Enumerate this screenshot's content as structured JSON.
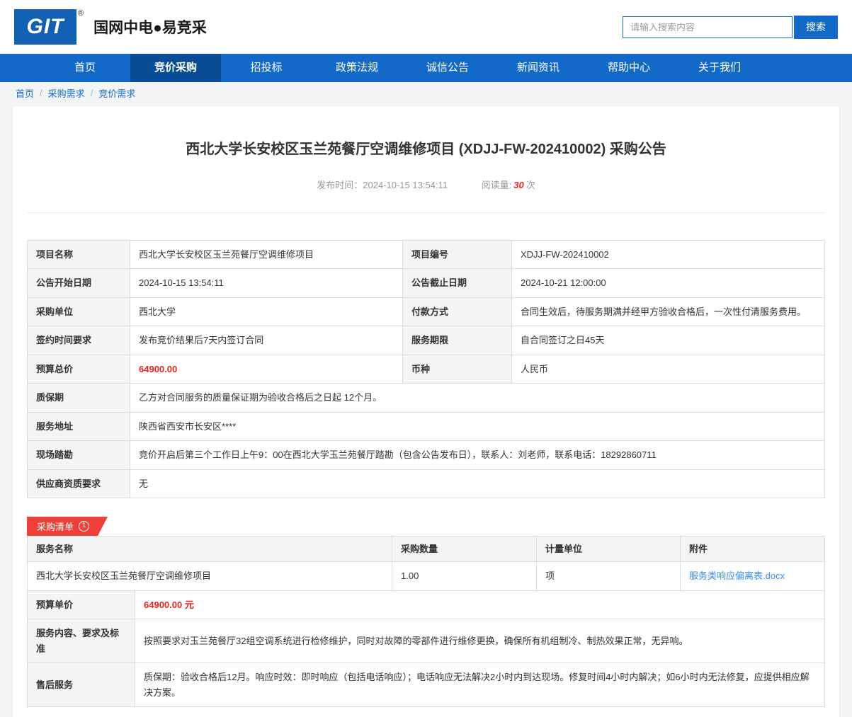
{
  "colors": {
    "brand-blue": "#1269c7",
    "nav-active": "#0a4d94",
    "accent-red": "#ee4038",
    "price-red": "#e6231f",
    "link-blue": "#3a8ee6"
  },
  "header": {
    "logo_text": "GIT",
    "logo_reg": "®",
    "site_title": "国网中电●易竞采",
    "search_placeholder": "请输入搜索内容",
    "search_button": "搜索"
  },
  "nav": {
    "items": [
      {
        "label": "首页"
      },
      {
        "label": "竞价采购"
      },
      {
        "label": "招投标"
      },
      {
        "label": "政策法规"
      },
      {
        "label": "诚信公告"
      },
      {
        "label": "新闻资讯"
      },
      {
        "label": "帮助中心"
      },
      {
        "label": "关于我们"
      }
    ]
  },
  "breadcrumb": {
    "sep": "/",
    "items": [
      "首页",
      "采购需求",
      "竞价需求"
    ]
  },
  "announcement": {
    "title": "西北大学长安校区玉兰苑餐厅空调维修项目 (XDJJ-FW-202410002) 采购公告",
    "publish_label": "发布时间：",
    "publish_time": "2024-10-15 13:54:11",
    "views_label": "阅读量:",
    "views_count": "30",
    "views_unit": "次"
  },
  "info": {
    "rows4": [
      {
        "l1": "项目名称",
        "v1": "西北大学长安校区玉兰苑餐厅空调维修项目",
        "l2": "项目编号",
        "v2": "XDJJ-FW-202410002"
      },
      {
        "l1": "公告开始日期",
        "v1": "2024-10-15 13:54:11",
        "l2": "公告截止日期",
        "v2": "2024-10-21 12:00:00"
      },
      {
        "l1": "采购单位",
        "v1": "西北大学",
        "l2": "付款方式",
        "v2": "合同生效后，待服务期满并经甲方验收合格后，一次性付清服务费用。"
      },
      {
        "l1": "签约时间要求",
        "v1": "发布竞价结果后7天内签订合同",
        "l2": "服务期限",
        "v2": "自合同签订之日45天"
      },
      {
        "l1": "预算总价",
        "v1": "64900.00",
        "l2": "币种",
        "v2": "人民币"
      }
    ],
    "rows2": [
      {
        "l": "质保期",
        "v": "乙方对合同服务的质量保证期为验收合格后之日起 12个月。"
      },
      {
        "l": "服务地址",
        "v": "陕西省西安市长安区****"
      },
      {
        "l": "现场踏勘",
        "v": "竞价开启后第三个工作日上午9：00在西北大学玉兰苑餐厅踏勘（包含公告发布日），联系人：刘老师，联系电话：18292860711"
      },
      {
        "l": "供应商资质要求",
        "v": "无"
      }
    ]
  },
  "purchase": {
    "tab_label": "采购清单",
    "tab_badge": "1",
    "headers": [
      "服务名称",
      "采购数量",
      "计量单位",
      "附件"
    ],
    "item": {
      "name": "西北大学长安校区玉兰苑餐厅空调维修项目",
      "qty": "1.00",
      "unit": "项",
      "attachment": "服务类响应偏离表.docx"
    },
    "details": [
      {
        "label": "预算单价",
        "value": "64900.00 元"
      },
      {
        "label": "服务内容、要求及标准",
        "value": "按照要求对玉兰苑餐厅32组空调系统进行检修维护，同时对故障的零部件进行维修更换，确保所有机组制冷、制热效果正常，无异响。"
      },
      {
        "label": "售后服务",
        "value": "质保期：验收合格后12月。响应时效：即时响应（包括电话响应）；电话响应无法解决2小时内到达现场。修复时间4小时内解决；如6小时内无法修复，应提供相应解决方案。"
      }
    ]
  }
}
